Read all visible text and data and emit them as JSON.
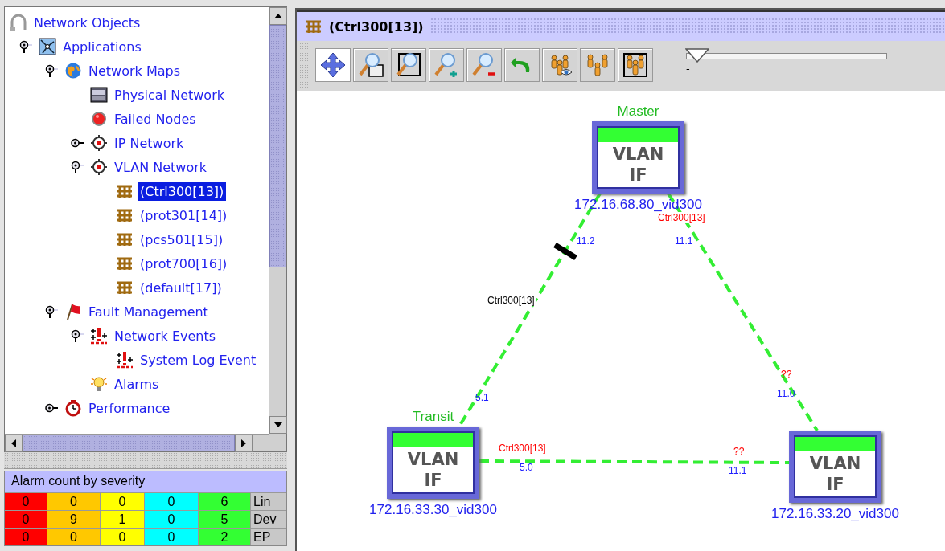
{
  "left_panel": {
    "tree": [
      {
        "label": "Network Objects",
        "kind": "root",
        "selected": false,
        "children": [
          {
            "label": "Applications",
            "kind": "application",
            "expanded": true,
            "selected": false,
            "children": [
              {
                "label": "Network Maps",
                "kind": "map",
                "expanded": true,
                "selected": false,
                "children": [
                  {
                    "label": "Physical Network",
                    "kind": "physical",
                    "selected": false
                  },
                  {
                    "label": "Failed Nodes",
                    "kind": "failed",
                    "selected": false
                  },
                  {
                    "label": "IP Network",
                    "kind": "network",
                    "expanded": false,
                    "selected": false
                  },
                  {
                    "label": "VLAN Network",
                    "kind": "network",
                    "expanded": true,
                    "selected": false,
                    "children": [
                      {
                        "label": "(Ctrl300[13])",
                        "kind": "vlan",
                        "selected": true
                      },
                      {
                        "label": "(prot301[14])",
                        "kind": "vlan",
                        "selected": false
                      },
                      {
                        "label": "(pcs501[15])",
                        "kind": "vlan",
                        "selected": false
                      },
                      {
                        "label": "(prot700[16])",
                        "kind": "vlan",
                        "selected": false
                      },
                      {
                        "label": "(default[17])",
                        "kind": "vlan",
                        "selected": false
                      }
                    ]
                  }
                ]
              },
              {
                "label": "Fault Management",
                "kind": "fault",
                "expanded": true,
                "selected": false,
                "children": [
                  {
                    "label": "Network Events",
                    "kind": "events",
                    "expanded": true,
                    "selected": false,
                    "children": [
                      {
                        "label": "System Log Event",
                        "kind": "events",
                        "selected": false
                      }
                    ]
                  },
                  {
                    "label": "Alarms",
                    "kind": "alarms",
                    "selected": false
                  }
                ]
              },
              {
                "label": "Performance",
                "kind": "performance",
                "expanded": false,
                "selected": false
              }
            ]
          }
        ]
      }
    ],
    "alarm_summary": {
      "title": "Alarm count by severity",
      "severities": [
        {
          "color": "#ff0000"
        },
        {
          "color": "#ffc800"
        },
        {
          "color": "#ffff00"
        },
        {
          "color": "#00ffff"
        },
        {
          "color": "#33ff33"
        }
      ],
      "rows": [
        {
          "counts": [
            "0",
            "0",
            "0",
            "0",
            "6"
          ],
          "label": "Lin"
        },
        {
          "counts": [
            "0",
            "9",
            "1",
            "0",
            "5"
          ],
          "label": "Dev"
        },
        {
          "counts": [
            "0",
            "0",
            "0",
            "0",
            "2"
          ],
          "label": "EP"
        }
      ]
    }
  },
  "map_window": {
    "title": "(Ctrl300[13])",
    "toolbar": [
      {
        "kind": "pan",
        "selected": true
      },
      {
        "kind": "zoom-fit",
        "selected": false
      },
      {
        "kind": "zoom-box",
        "selected": false
      },
      {
        "kind": "zoom-in",
        "selected": false
      },
      {
        "kind": "zoom-out",
        "selected": false
      },
      {
        "kind": "undo",
        "selected": false
      },
      {
        "kind": "group-view",
        "selected": false
      },
      {
        "kind": "spread",
        "selected": false
      },
      {
        "kind": "group-box",
        "selected": false
      }
    ],
    "zoom_slider": {
      "level": 0.04,
      "min_label": "-"
    },
    "map": {
      "nodes": [
        {
          "role": "Master",
          "label_lines": [
            "VLAN",
            "IF"
          ],
          "name": "172.16.68.80_vid300"
        },
        {
          "role": "Transit",
          "label_lines": [
            "VLAN",
            "IF"
          ],
          "name": "172.16.33.30_vid300"
        },
        {
          "label_lines": [
            "VLAN",
            "IF"
          ],
          "name": "172.16.33.20_vid300"
        }
      ],
      "links": [
        {
          "label": "Ctrl300[13]",
          "color": "#000000",
          "blocked": true,
          "ends": [
            {
              "port": "11.2"
            },
            {
              "port": "5.1"
            }
          ]
        },
        {
          "label": "Ctrl300[13]",
          "color": "#ff0000",
          "ends": [
            {
              "port": "11.1"
            },
            {
              "port": "11.0",
              "flag": "??"
            }
          ]
        },
        {
          "label": "Ctrl300[13]",
          "color": "#ff0000",
          "ends": [
            {
              "port": "5.0"
            },
            {
              "port": "11.1",
              "flag": "??"
            }
          ]
        }
      ]
    }
  }
}
